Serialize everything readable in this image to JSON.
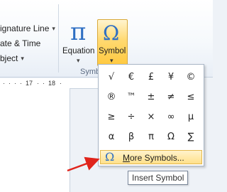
{
  "insert_group": {
    "signature_line_label": "ignature Line",
    "date_time_label": "ate & Time",
    "object_label": "bject"
  },
  "equation_button": {
    "glyph": "π",
    "label": "Equation"
  },
  "symbol_button": {
    "glyph": "Ω",
    "label": "Symbol"
  },
  "group_label": "Symb",
  "ruler": {
    "ticks": [
      "17",
      "18"
    ]
  },
  "symbol_gallery": {
    "symbols": [
      "√",
      "€",
      "£",
      "¥",
      "©",
      "®",
      "™",
      "±",
      "≠",
      "≤",
      "≥",
      "÷",
      "×",
      "∞",
      "µ",
      "α",
      "β",
      "π",
      "Ω",
      "∑"
    ]
  },
  "more_symbols": {
    "icon": "Ω",
    "label_underlined": "M",
    "label_rest": "ore Symbols..."
  },
  "tooltip": {
    "text": "Insert Symbol"
  },
  "colors": {
    "arrow": "#e0241b",
    "icon_blue": "#2f6fc3",
    "highlight": "#ffd970"
  }
}
